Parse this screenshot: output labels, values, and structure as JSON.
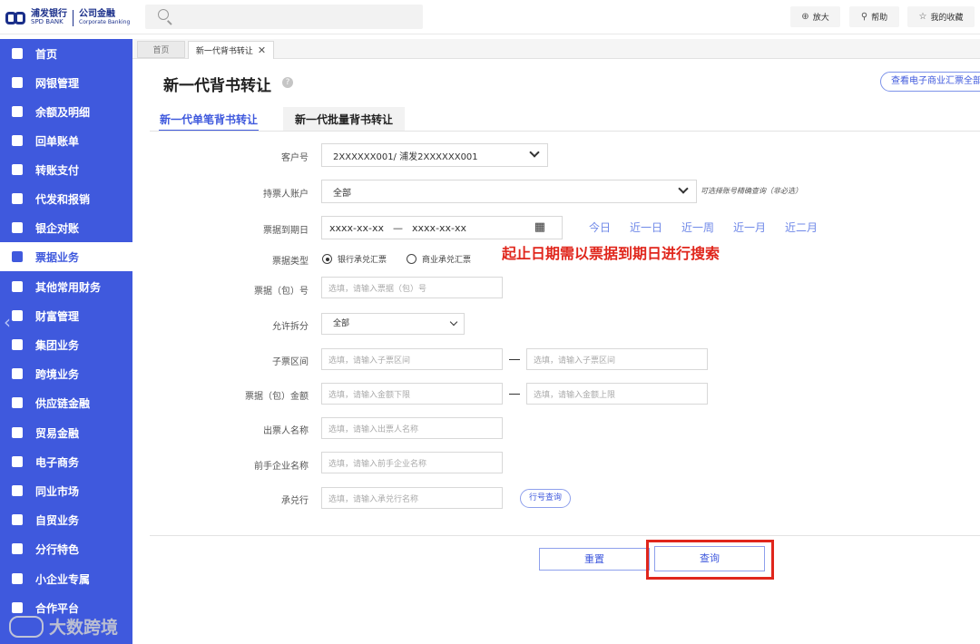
{
  "brand": {
    "name_cn": "浦发银行",
    "name_en": "SPD BANK",
    "corp_cn": "公司金融",
    "corp_en": "Corporate Banking"
  },
  "topbar": {
    "zoom_label": "放大",
    "help_label": "帮助",
    "favorites_label": "我的收藏"
  },
  "sidebar": {
    "items": [
      {
        "label": "首页"
      },
      {
        "label": "网银管理"
      },
      {
        "label": "余额及明细"
      },
      {
        "label": "回单账单"
      },
      {
        "label": "转账支付"
      },
      {
        "label": "代发和报销"
      },
      {
        "label": "银企对账"
      },
      {
        "label": "票据业务"
      },
      {
        "label": "其他常用财务"
      },
      {
        "label": "财富管理"
      },
      {
        "label": "集团业务"
      },
      {
        "label": "跨境业务"
      },
      {
        "label": "供应链金融"
      },
      {
        "label": "贸易金融"
      },
      {
        "label": "电子商务"
      },
      {
        "label": "同业市场"
      },
      {
        "label": "自贸业务"
      },
      {
        "label": "分行特色"
      },
      {
        "label": "小企业专属"
      },
      {
        "label": "合作平台"
      }
    ],
    "active_index": 7
  },
  "tabs": {
    "home": "首页",
    "current": "新一代背书转让"
  },
  "page": {
    "title": "新一代背书转让",
    "view_button": "查看电子商业汇票全部",
    "subtab_single": "新一代单笔背书转让",
    "subtab_batch": "新一代批量背书转让"
  },
  "form": {
    "customer_label": "客户号",
    "customer_value": "2XXXXXX001/ 浦发2XXXXXX001",
    "holder_label": "持票人账户",
    "holder_value": "全部",
    "holder_hint": "可选择账号精确查询（非必选）",
    "due_label": "票据到期日",
    "due_start": "xxxx-xx-xx",
    "due_sep": "—",
    "due_end": "xxxx-xx-xx",
    "quick_today": "今日",
    "quick_1d": "近一日",
    "quick_1w": "近一周",
    "quick_1m": "近一月",
    "quick_2m": "近二月",
    "note": "起止日期需以票据到期日进行搜索",
    "type_label": "票据类型",
    "type_bank": "银行承兑汇票",
    "type_commercial": "商业承兑汇票",
    "bill_no_label": "票据（包）号",
    "bill_no_ph": "选填，请输入票据（包）号",
    "split_label": "允许拆分",
    "split_value": "全部",
    "sub_range_label": "子票区间",
    "sub_range_from_ph": "选填，请输入子票区间",
    "sub_range_to_ph": "选填，请输入子票区间",
    "amount_label": "票据（包）金额",
    "amount_min_ph": "选填，请输入金额下限",
    "amount_max_ph": "选填，请输入金额上限",
    "drawer_label": "出票人名称",
    "drawer_ph": "选填，请输入出票人名称",
    "prev_label": "前手企业名称",
    "prev_ph": "选填，请输入前手企业名称",
    "acceptor_label": "承兑行",
    "acceptor_ph": "选填，请输入承兑行名称",
    "bank_lookup": "行号查询"
  },
  "actions": {
    "reset": "重置",
    "query": "查询"
  },
  "watermark": "大数跨境"
}
